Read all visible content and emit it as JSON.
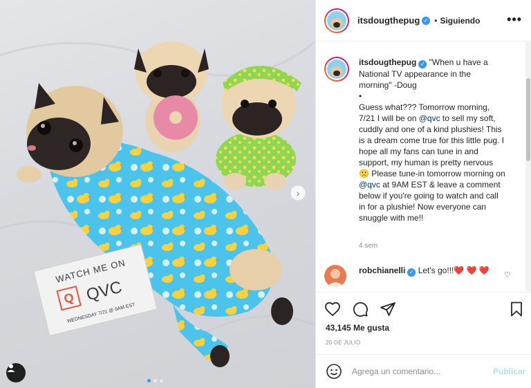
{
  "post_author": {
    "username": "itsdougthepug",
    "follow_separator": "•",
    "follow_status": "Siguiendo",
    "more_label": "•••"
  },
  "photo": {
    "sign_line1": "WATCH ME ON",
    "sign_brand": "QVC",
    "sign_line3": "WEDNESDAY 7/21 @ 9AM EST"
  },
  "caption": {
    "username": "itsdougthepug",
    "text_part1": "\"When u have a National TV appearance in the morning\" -Doug",
    "bullet": "•",
    "text_part2": "Guess what??? Tomorrow morning, 7/21 I will be on ",
    "mention1": "@qvc",
    "text_part3": " to sell my soft, cuddly and one of a kind plushies! This is a dream come true for this little pug. I hope all my fans can tune in and support, my human is pretty nervous 🙁 Please tune-in tomorrow morning on ",
    "mention2": "@qvc",
    "text_part4": " at 9AM EST & leave a comment below if you're going to watch and call in for a plushie! Now everyone can snuggle with me!!",
    "time_ago": "4 sem"
  },
  "comment": {
    "username": "robchianelli",
    "text": "Let's go!!!❤️ ❤️ ❤️"
  },
  "stats": {
    "likes": "43,145 Me gusta",
    "date": "20 DE JULIO"
  },
  "composer": {
    "placeholder": "Agrega un comentario...",
    "publish_label": "Publicar"
  },
  "icons": {
    "like": "heart-icon",
    "comment": "comment-icon",
    "share": "paper-plane-icon",
    "save": "bookmark-icon",
    "emoji": "smiley-icon",
    "tag": "user-tag-icon",
    "next": "chevron-right-icon"
  },
  "colors": {
    "link": "#00376b",
    "verified": "#3897f0",
    "publish_disabled": "#b2dffc",
    "like_heart": "#e0242b"
  }
}
